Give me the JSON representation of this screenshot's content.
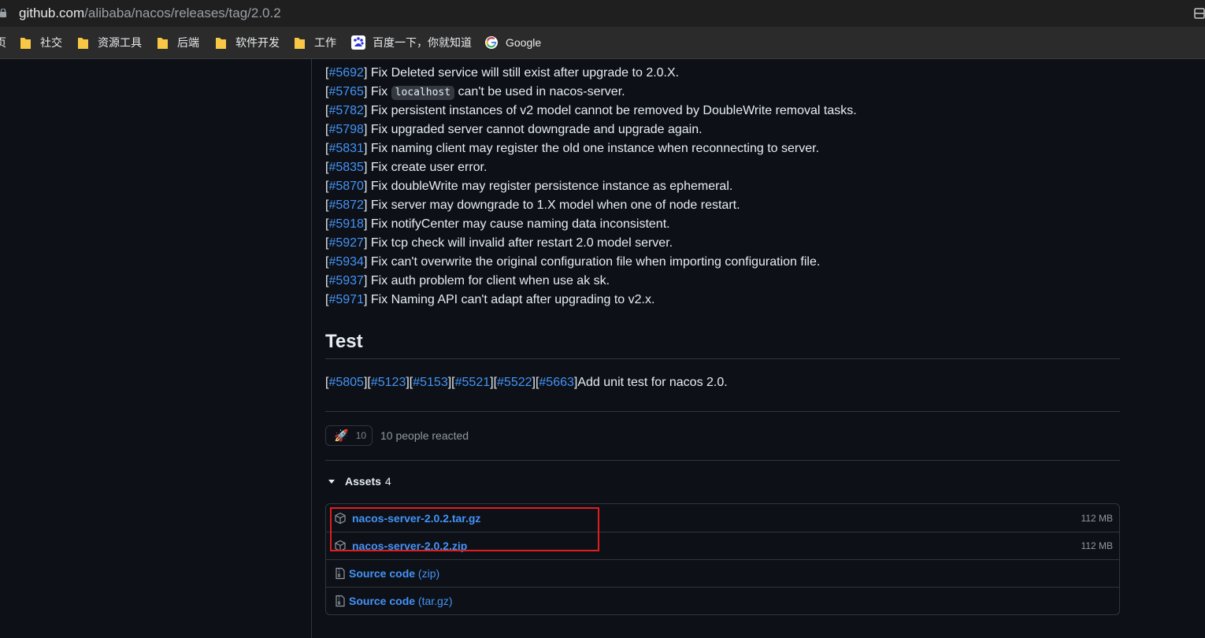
{
  "browser": {
    "url_host": "github.com",
    "url_path": "/alibaba/nacos/releases/tag/2.0.2",
    "bookmarks": [
      {
        "label": "页",
        "icon": "partial-item"
      },
      {
        "label": "社交",
        "icon": "folder-icon"
      },
      {
        "label": "资源工具",
        "icon": "folder-icon"
      },
      {
        "label": "后端",
        "icon": "folder-icon"
      },
      {
        "label": "软件开发",
        "icon": "folder-icon"
      },
      {
        "label": "工作",
        "icon": "folder-icon"
      },
      {
        "label": "百度一下，你就知道",
        "icon": "baidu-icon"
      },
      {
        "label": "Google",
        "icon": "google-icon"
      }
    ]
  },
  "fixes": [
    {
      "id": "#5692",
      "text": "Fix Deleted service will still exist after upgrade to 2.0.X."
    },
    {
      "id": "#5765",
      "text_before": "Fix",
      "code": "localhost",
      "text_after": "can't be used in nacos-server."
    },
    {
      "id": "#5782",
      "text": "Fix persistent instances of v2 model cannot be removed by DoubleWrite removal tasks."
    },
    {
      "id": "#5798",
      "text": "Fix upgraded server cannot downgrade and upgrade again."
    },
    {
      "id": "#5831",
      "text": "Fix naming client may register the old one instance when reconnecting to server."
    },
    {
      "id": "#5835",
      "text": "Fix create user error."
    },
    {
      "id": "#5870",
      "text": "Fix doubleWrite may register persistence instance as ephemeral."
    },
    {
      "id": "#5872",
      "text": "Fix server may downgrade to 1.X model when one of node restart."
    },
    {
      "id": "#5918",
      "text": "Fix notifyCenter may cause naming data inconsistent."
    },
    {
      "id": "#5927",
      "text": "Fix tcp check will invalid after restart 2.0 model server."
    },
    {
      "id": "#5934",
      "text": "Fix can't overwrite the original configuration file when importing configuration file."
    },
    {
      "id": "#5937",
      "text": "Fix auth problem for client when use ak sk."
    },
    {
      "id": "#5971",
      "text": "Fix Naming API can't adapt after upgrading to v2.x."
    }
  ],
  "test": {
    "heading": "Test",
    "links": [
      "#5805",
      "#5123",
      "#5153",
      "#5521",
      "#5522",
      "#5663"
    ],
    "text": "Add unit test for nacos 2.0."
  },
  "reactions": {
    "emoji": "🚀",
    "count": "10",
    "summary": "10 people reacted"
  },
  "assets": {
    "label": "Assets",
    "count": "4",
    "files": [
      {
        "name": "nacos-server-2.0.2.tar.gz",
        "size": "112 MB"
      },
      {
        "name": "nacos-server-2.0.2.zip",
        "size": "112 MB"
      }
    ],
    "source": [
      {
        "name": "Source code",
        "kind": "(zip)"
      },
      {
        "name": "Source code",
        "kind": "(tar.gz)"
      }
    ]
  },
  "colors": {
    "background": "#0d1117",
    "link": "#4493f8",
    "border": "#30363d",
    "highlight_box": "#e01e1e"
  }
}
